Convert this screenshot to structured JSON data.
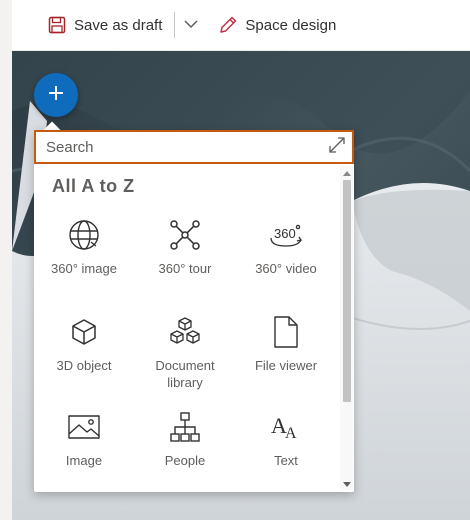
{
  "toolbar": {
    "save_draft_label": "Save as draft",
    "space_design_label": "Space design"
  },
  "picker": {
    "search_placeholder": "Search",
    "section_title": "All A to Z",
    "items": [
      {
        "label": "360° image",
        "icon": "globe-icon"
      },
      {
        "label": "360° tour",
        "icon": "network-nodes-icon"
      },
      {
        "label": "360° video",
        "icon": "video-360-icon"
      },
      {
        "label": "3D object",
        "icon": "cube-icon"
      },
      {
        "label": "Document library",
        "icon": "cubes-stack-icon"
      },
      {
        "label": "File viewer",
        "icon": "file-icon"
      },
      {
        "label": "Image",
        "icon": "image-icon"
      },
      {
        "label": "People",
        "icon": "org-chart-icon"
      },
      {
        "label": "Text",
        "icon": "text-aa-icon"
      }
    ]
  },
  "colors": {
    "accent_blue": "#0f6cbd",
    "search_border": "#c55a11",
    "save_icon": "#a4262c",
    "pencil_icon": "#c4314b"
  }
}
